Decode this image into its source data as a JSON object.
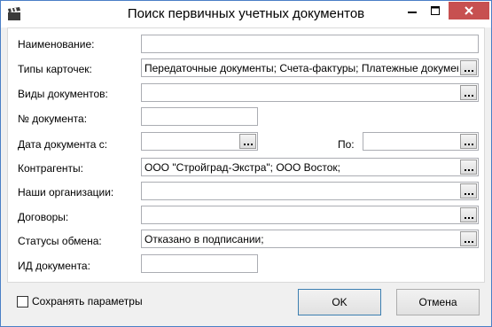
{
  "window": {
    "title": "Поиск первичных учетных документов"
  },
  "form": {
    "name_label": "Наименование:",
    "name_value": "",
    "card_types_label": "Типы карточек:",
    "card_types_value": "Передаточные документы; Счета-фактуры; Платежные документы",
    "doc_kinds_label": "Виды документов:",
    "doc_kinds_value": "",
    "doc_number_label": "№ документа:",
    "doc_number_value": "",
    "date_from_label": "Дата документа с:",
    "date_from_value": "",
    "date_to_label": "По:",
    "date_to_value": "",
    "contractors_label": "Контрагенты:",
    "contractors_value": "ООО \"Стройград-Экстра\"; ООО Восток;",
    "our_orgs_label": "Наши организации:",
    "our_orgs_value": "",
    "contracts_label": "Договоры:",
    "contracts_value": "",
    "exchange_status_label": "Статусы обмена:",
    "exchange_status_value": "Отказано в подписании;",
    "doc_id_label": "ИД документа:",
    "doc_id_value": ""
  },
  "footer": {
    "save_params_label": "Сохранять параметры",
    "save_params_checked": false,
    "ok_label": "OK",
    "cancel_label": "Отмена"
  },
  "icons": {
    "app": "clapperboard-icon",
    "minimize": "minimize-icon",
    "maximize": "maximize-icon",
    "close": "close-icon",
    "browse": "ellipsis-icon"
  },
  "colors": {
    "close_button": "#c75050",
    "window_border": "#4a7fc6",
    "field_border": "#abadb3"
  }
}
